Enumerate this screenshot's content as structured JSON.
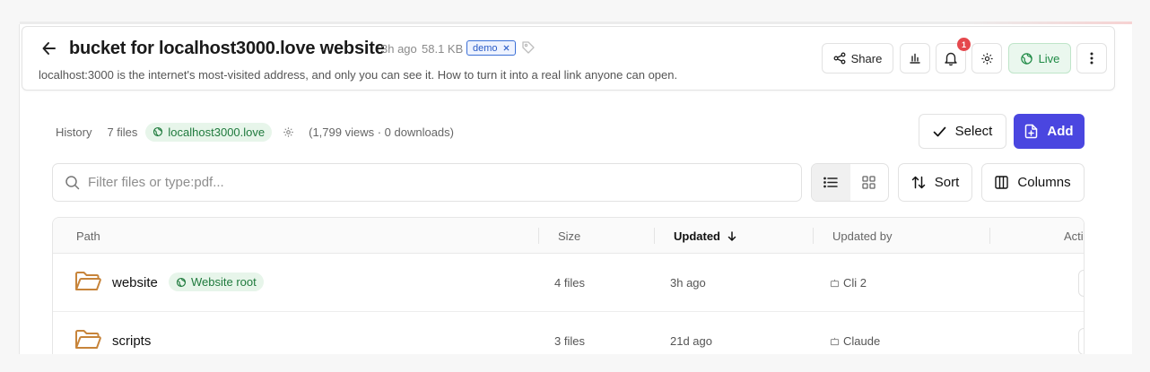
{
  "header": {
    "title": "bucket for localhost3000.love website",
    "age": "3h ago",
    "size": "58.1 KB",
    "tag": "demo",
    "subtitle": "localhost:3000 is the internet's most-visited address, and only you can see it. How to turn it into a real link anyone can open.",
    "share_label": "Share",
    "notification_count": "1",
    "live_label": "Live"
  },
  "toolbar": {
    "history_label": "History",
    "files_count": "7 files",
    "domain": "localhost3000.love",
    "stats": "(1,799 views · 0 downloads)",
    "select_label": "Select",
    "add_label": "Add",
    "search_placeholder": "Filter files or type:pdf...",
    "sort_label": "Sort",
    "columns_label": "Columns"
  },
  "table": {
    "headers": {
      "path": "Path",
      "size": "Size",
      "updated": "Updated",
      "updated_by": "Updated by",
      "actions": "Actions"
    },
    "rows": [
      {
        "name": "website",
        "badge": "Website root",
        "size": "4 files",
        "updated": "3h ago",
        "updated_by": "Cli 2"
      },
      {
        "name": "scripts",
        "badge": "",
        "size": "3 files",
        "updated": "21d ago",
        "updated_by": "Claude"
      }
    ]
  },
  "colors": {
    "accent": "#4a46e0",
    "live_green": "#1f8a45",
    "folder": "#c7843a",
    "badge_red": "#e5484d"
  },
  "icons": [
    "back-arrow-icon",
    "tag-icon",
    "share-icon",
    "chart-icon",
    "bell-icon",
    "gear-icon",
    "live-globe-icon",
    "more-vertical-icon",
    "globe-icon",
    "settings-icon",
    "check-icon",
    "add-file-icon",
    "search-icon",
    "list-view-icon",
    "grid-view-icon",
    "sort-icon",
    "columns-icon",
    "folder-icon",
    "bot-icon"
  ]
}
